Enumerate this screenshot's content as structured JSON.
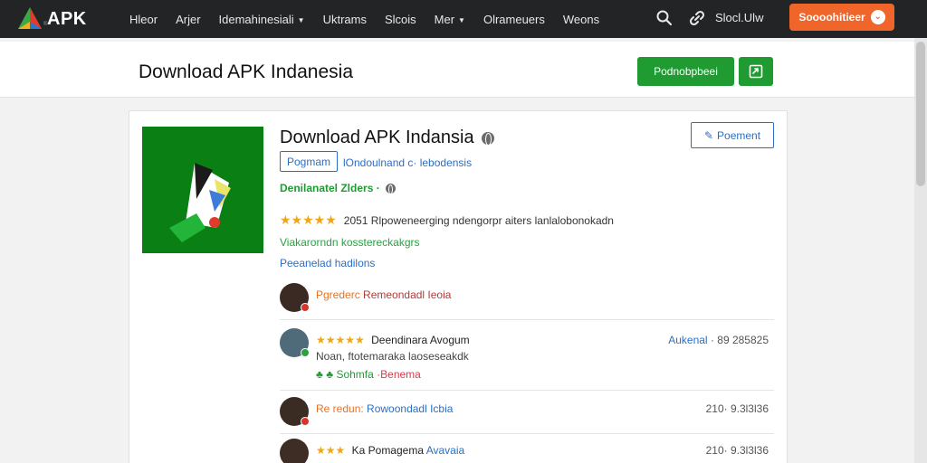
{
  "nav": {
    "logo_text": "APK",
    "logo_sub": "®",
    "items": [
      "Hleor",
      "Arjer",
      "Idemahinesiali",
      "Uktrams",
      "Slcois",
      "Mer",
      "Olrameuers",
      "Weons"
    ],
    "signin": "Slocl.Ulw",
    "cta": "Soooohitieer"
  },
  "header": {
    "title": "Download APK Indanesia",
    "download_label": "Podnobpbeei"
  },
  "app": {
    "title": "Download APK Indansia",
    "report_label": "Poement",
    "tag_label": "Pogmam",
    "tag_link": "lOndoulnand c· lebodensis",
    "developer": "Denilanatel Zlders ·",
    "rating_stars": "★★★★★",
    "rating_text": "2051 Rlpoweneerging ndengorpr aiters lanlalobonokadn",
    "info_green": "Viakarorndn kosstereckakgrs",
    "info_blue": "Peeanelad hadilons"
  },
  "reviews": [
    {
      "prefix": "Pgrederc",
      "title": "Remeondadl Ieoia",
      "stars": "",
      "text": "",
      "meta_a": "",
      "meta_b": "",
      "right_blue": "",
      "right": ""
    },
    {
      "prefix": "",
      "title": "Deendinara Avogum",
      "stars": "★★★★★",
      "text": "Noan, ftotemaraka laoseseakdk",
      "meta_a": "Sohmfa",
      "meta_b": "·Benema",
      "right_blue": "Aukenal",
      "right": "· 89 285825"
    },
    {
      "prefix": "Re redun:",
      "title": "Rowoondadl Icbia",
      "stars": "",
      "text": "",
      "meta_a": "",
      "meta_b": "",
      "right_blue": "",
      "right": "210· 9.3l3l36"
    },
    {
      "prefix": "",
      "title": "Avavaia",
      "name_black": "Ka Pomagema",
      "stars": "★★★",
      "text": "",
      "meta_a": "",
      "meta_b": "",
      "right_blue": "",
      "right": "210· 9.3l3l36"
    }
  ],
  "colors": {
    "topbar": "#222426",
    "accent_orange": "#f0652a",
    "brand_green": "#1f9b32",
    "link_blue": "#2b6fc4",
    "star": "#f1a613"
  }
}
